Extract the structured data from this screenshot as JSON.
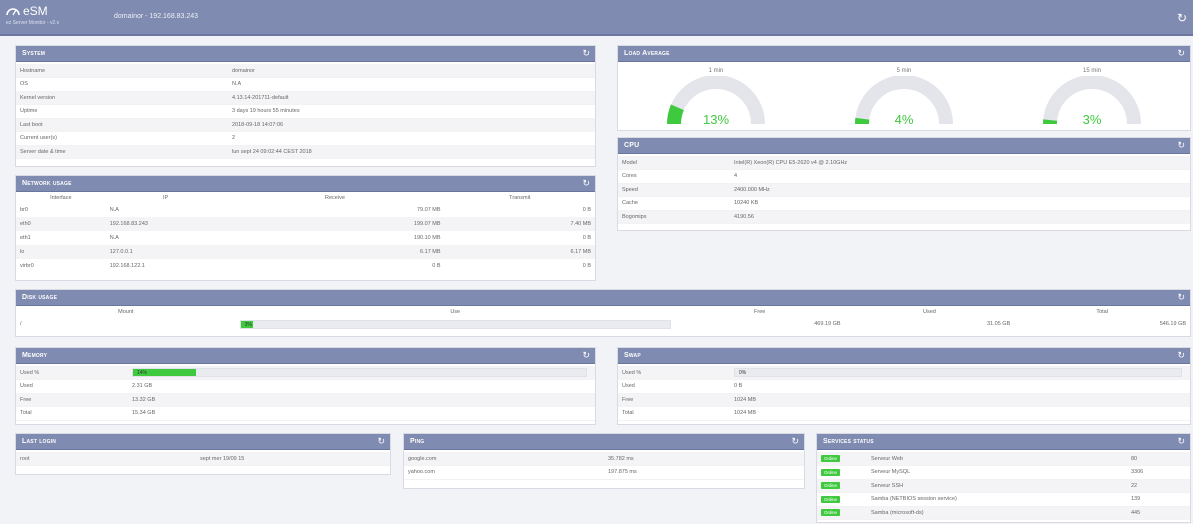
{
  "header": {
    "app_name": "eSM",
    "app_subtitle": "ez Server Monitor - v2.x",
    "host_info": "domainor - 192.168.83.243"
  },
  "system": {
    "title": "System",
    "rows": [
      {
        "label": "Hostname",
        "value": "domainor"
      },
      {
        "label": "OS",
        "value": "N.A"
      },
      {
        "label": "Kernel version",
        "value": "4.13.14-201711-default"
      },
      {
        "label": "Uptime",
        "value": "3 days 19 hours 55 minutes"
      },
      {
        "label": "Last boot",
        "value": "2018-09-18 14:07:06"
      },
      {
        "label": "Current user(s)",
        "value": "2"
      },
      {
        "label": "Server date & time",
        "value": "lun sept 24 09:02:44 CEST 2018"
      }
    ]
  },
  "load_average": {
    "title": "Load Average",
    "gauges": [
      {
        "label": "1 min",
        "value": "13%",
        "percent": 13
      },
      {
        "label": "5 min",
        "value": "4%",
        "percent": 4
      },
      {
        "label": "15 min",
        "value": "3%",
        "percent": 3
      }
    ]
  },
  "cpu": {
    "title": "CPU",
    "rows": [
      {
        "label": "Model",
        "value": "Intel(R) Xeon(R) CPU E5-2620 v4 @ 2.10GHz"
      },
      {
        "label": "Cores",
        "value": "4"
      },
      {
        "label": "Speed",
        "value": "2400.000 MHz"
      },
      {
        "label": "Cache",
        "value": "10240 KB"
      },
      {
        "label": "Bogomips",
        "value": "4190.56"
      }
    ]
  },
  "network": {
    "title": "Network usage",
    "columns": [
      "Interface",
      "IP",
      "Receive",
      "Transmit"
    ],
    "rows": [
      {
        "iface": "br0",
        "ip": "N.A",
        "receive": "79.07 MB",
        "transmit": "0 B"
      },
      {
        "iface": "eth0",
        "ip": "192.168.83.243",
        "receive": "199.07 MB",
        "transmit": "7.40 MB"
      },
      {
        "iface": "eth1",
        "ip": "N.A",
        "receive": "190.10 MB",
        "transmit": "0 B"
      },
      {
        "iface": "lo",
        "ip": "127.0.0.1",
        "receive": "6.17 MB",
        "transmit": "6.17 MB"
      },
      {
        "iface": "virbr0",
        "ip": "192.168.122.1",
        "receive": "0 B",
        "transmit": "0 B"
      }
    ]
  },
  "disk": {
    "title": "Disk usage",
    "columns": [
      "Mount",
      "Use",
      "Free",
      "Used",
      "Total"
    ],
    "rows": [
      {
        "mount": "/",
        "use": "3%",
        "percent": 3,
        "free": "469.19 GB",
        "used": "31.05 GB",
        "total": "546.19 GB"
      }
    ]
  },
  "memory": {
    "title": "Memory",
    "used_label": "Used %",
    "used_value": "14%",
    "used_percent": 14,
    "rows": [
      {
        "label": "Used",
        "value": "2.31 GB"
      },
      {
        "label": "Free",
        "value": "13.32 GB"
      },
      {
        "label": "Total",
        "value": "15.34 GB"
      }
    ]
  },
  "swap": {
    "title": "Swap",
    "used_label": "Used %",
    "used_value": "0%",
    "used_percent": 0,
    "rows": [
      {
        "label": "Used",
        "value": "0 B"
      },
      {
        "label": "Free",
        "value": "1024 MB"
      },
      {
        "label": "Total",
        "value": "1024 MB"
      }
    ]
  },
  "last_login": {
    "title": "Last login",
    "rows": [
      {
        "user": "root",
        "date": "sept mer 19/09 15"
      }
    ]
  },
  "ping": {
    "title": "Ping",
    "rows": [
      {
        "host": "google.com",
        "time": "35.782 ms"
      },
      {
        "host": "yahoo.com",
        "time": "197.875 ms"
      }
    ]
  },
  "services": {
    "title": "Services status",
    "status_label": "Online",
    "rows": [
      {
        "name": "Serveur Web",
        "port": "80"
      },
      {
        "name": "Serveur MySQL",
        "port": "3306"
      },
      {
        "name": "Serveur SSH",
        "port": "22"
      },
      {
        "name": "Samba (NETBIOS session service)",
        "port": "139"
      },
      {
        "name": "Samba (microsoft-ds)",
        "port": "445"
      }
    ]
  },
  "colors": {
    "header_bg": "#7f8bb0",
    "accent_green": "#3ec93e",
    "page_bg": "#f2f3f6"
  }
}
